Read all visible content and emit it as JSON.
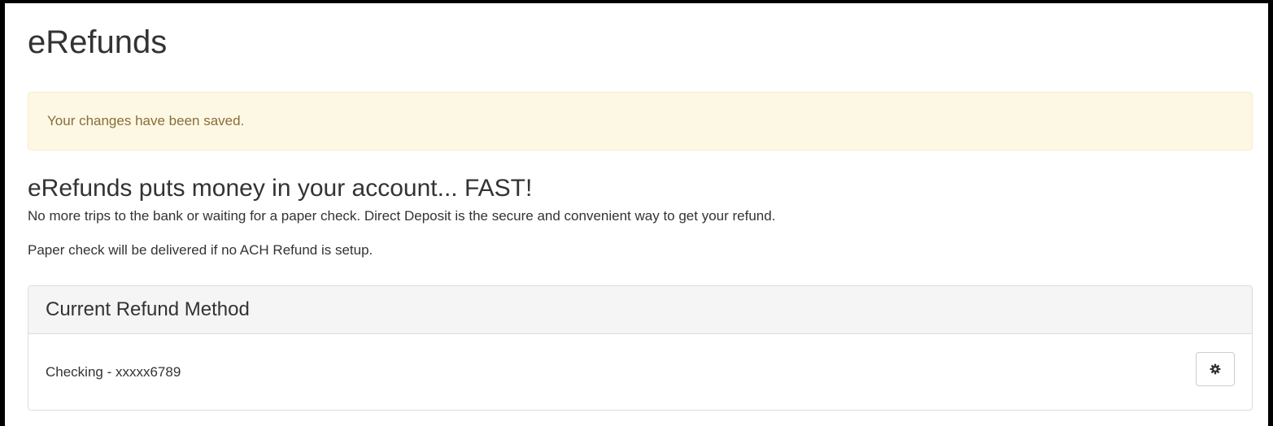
{
  "page": {
    "title": "eRefunds"
  },
  "alert": {
    "message": "Your changes have been saved.",
    "background": "#fcf8e3",
    "text_color": "#8a6d3b"
  },
  "promo": {
    "heading": "eRefunds puts money in your account... FAST!",
    "text": "No more trips to the bank or waiting for a paper check. Direct Deposit is the secure and convenient way to get your refund.",
    "note": "Paper check will be delivered if no ACH Refund is setup."
  },
  "refund_panel": {
    "heading": "Current Refund Method",
    "method": "Checking - xxxxx6789",
    "settings_icon": "gear-icon"
  }
}
